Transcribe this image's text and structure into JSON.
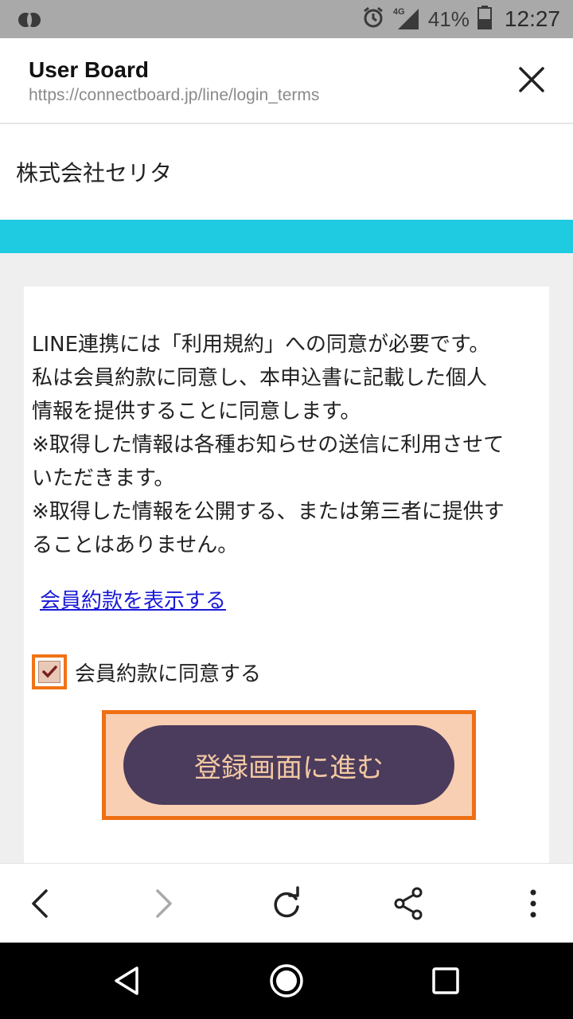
{
  "status_bar": {
    "network": "4G",
    "battery": "41%",
    "time": "12:27",
    "icons": [
      "app-icon",
      "alarm-icon",
      "signal-icon",
      "battery-icon"
    ]
  },
  "browser": {
    "title": "User Board",
    "url": "https://connectboard.jp/line/login_terms",
    "close_icon": "close-icon"
  },
  "company": {
    "name": "株式会社セリタ",
    "accent_color": "#1fcbe0"
  },
  "terms": {
    "lines": [
      "LINE連携には「利用規約」への同意が必要です。",
      "私は会員約款に同意し、本申込書に記載した個人",
      "情報を提供することに同意します。",
      "※取得した情報は各種お知らせの送信に利用させて",
      "いただきます。",
      "※取得した情報を公開する、または第三者に提供す",
      "ることはありません。"
    ],
    "link_label": "会員約款を表示する",
    "agree_label": "会員約款に同意する",
    "agree_checked": true,
    "submit_label": "登録画面に進む",
    "submit_color": "#4b3b5c",
    "highlight_color": "#ee6f14"
  },
  "toolbar": {
    "items": [
      "back-icon",
      "forward-icon",
      "reload-icon",
      "share-icon",
      "more-icon"
    ]
  },
  "navbar": {
    "items": [
      "nav-back-icon",
      "nav-home-icon",
      "nav-recents-icon"
    ]
  }
}
